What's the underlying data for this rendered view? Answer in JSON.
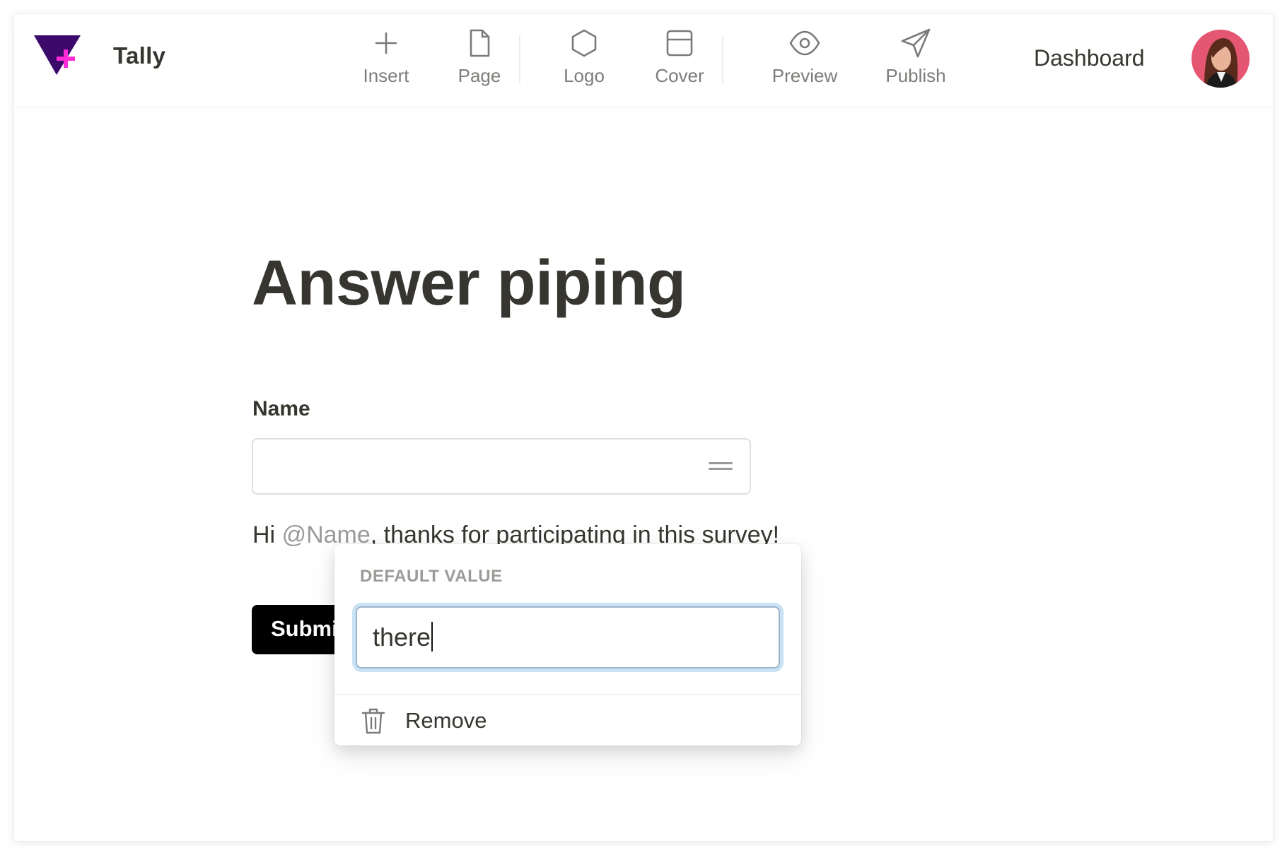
{
  "app": {
    "name": "Tally"
  },
  "toolbar": {
    "items": [
      {
        "label": "Insert",
        "icon": "plus-icon"
      },
      {
        "label": "Page",
        "icon": "page-icon"
      },
      {
        "label": "Logo",
        "icon": "hexagon-icon"
      },
      {
        "label": "Cover",
        "icon": "cover-icon"
      },
      {
        "label": "Preview",
        "icon": "eye-icon"
      },
      {
        "label": "Publish",
        "icon": "send-icon"
      }
    ]
  },
  "header": {
    "dashboard_label": "Dashboard",
    "avatar": "user-avatar"
  },
  "form": {
    "title": "Answer piping",
    "name_label": "Name",
    "name_value": "",
    "sentence_prefix": "Hi ",
    "sentence_mention": "@Name",
    "sentence_suffix": ", thanks for participating in this survey!",
    "submit_label": "Submit"
  },
  "popover": {
    "heading": "DEFAULT VALUE",
    "default_value": "there",
    "remove_label": "Remove"
  },
  "colors": {
    "brand_purple": "#3b0a6b",
    "brand_pink": "#ff2bd6",
    "text": "#37352f",
    "muted": "#9b9a97",
    "focus_ring": "#c9e3f4",
    "submit_bg": "#000000"
  }
}
